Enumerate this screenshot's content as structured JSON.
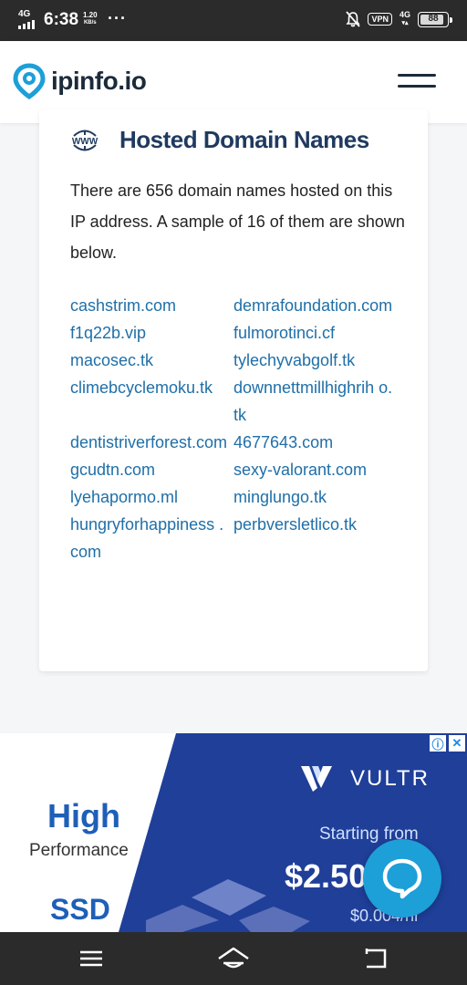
{
  "status_bar": {
    "network": "4G",
    "time": "6:38",
    "speed_value": "1.20",
    "speed_unit": "KB/s",
    "more": "···",
    "vpn": "VPN",
    "network2": "4G",
    "battery": "88",
    "battery_level": 0.88
  },
  "header": {
    "logo_text": "ipinfo.io",
    "logo_icon": "map-pin-icon",
    "menu_icon": "hamburger-menu-icon"
  },
  "hosted": {
    "icon": "www-globe-icon",
    "title": "Hosted Domain Names",
    "description": "There are 656 domain names hosted on this IP address. A sample of 16 of them are shown below.",
    "domains": [
      "cashstrim.com",
      "demrafoundation.com",
      "f1q22b.vip",
      "fulmorotinci.cf",
      "macosec.tk",
      "tylechyvabgolf.tk",
      "climebcyclemoku.tk",
      "downnettmillhighrih o.tk",
      "dentistriverforest.com",
      "4677643.com",
      "gcudtn.com",
      "sexy-valorant.com",
      "lyehapormo.ml",
      "minglungo.tk",
      "hungryforhappiness .com",
      "perbversletlico.tk"
    ]
  },
  "ad": {
    "left_high": "High",
    "left_performance": "Performance",
    "left_ssd": "SSD",
    "brand": "VULTR",
    "starting": "Starting from",
    "price": "$2.50",
    "hourly": "$0.004/hr",
    "info_icon": "ⓘ",
    "close_icon": "✕",
    "colors": {
      "blue_panel": "#1f3f99",
      "text_blue": "#1e5fb8",
      "chat": "#1d9fd8"
    }
  },
  "nav": {
    "menu_icon": "recent-apps-icon",
    "home_icon": "home-icon",
    "back_icon": "back-icon"
  }
}
